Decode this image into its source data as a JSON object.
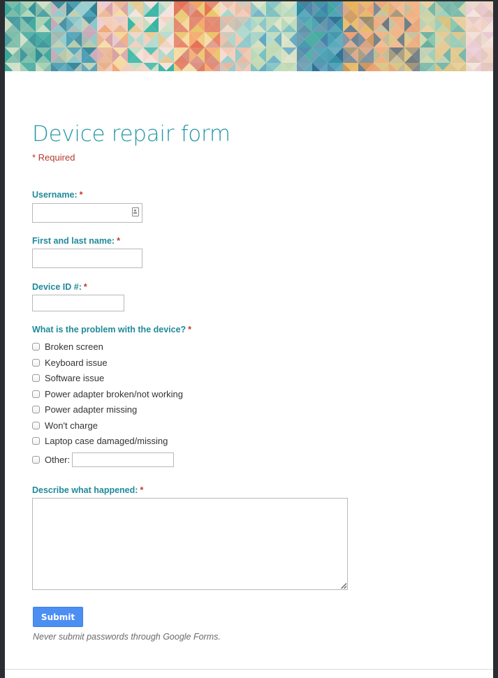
{
  "form": {
    "title": "Device repair form",
    "required_note": "* Required",
    "required_marker": "*",
    "fields": {
      "username": {
        "label": "Username:",
        "value": ""
      },
      "full_name": {
        "label": "First and last name:",
        "value": ""
      },
      "device_id": {
        "label": "Device ID #:",
        "value": ""
      },
      "problem": {
        "label": "What is the problem with the device?",
        "options": [
          {
            "label": "Broken screen",
            "checked": false
          },
          {
            "label": "Keyboard issue",
            "checked": false
          },
          {
            "label": "Software issue",
            "checked": false
          },
          {
            "label": "Power adapter broken/not working",
            "checked": false
          },
          {
            "label": "Power adapter missing",
            "checked": false
          },
          {
            "label": "Won't charge",
            "checked": false
          },
          {
            "label": "Laptop case damaged/missing",
            "checked": false
          },
          {
            "label": "Other:",
            "checked": false,
            "other_value": ""
          }
        ]
      },
      "description": {
        "label": "Describe what happened:",
        "value": ""
      }
    },
    "submit_label": "Submit",
    "disclaimer": "Never submit passwords through Google Forms."
  },
  "colors": {
    "title": "#2597a8",
    "label": "#1f8a9a",
    "required": "#c0392b",
    "submit_bg": "#4d8ef3"
  }
}
